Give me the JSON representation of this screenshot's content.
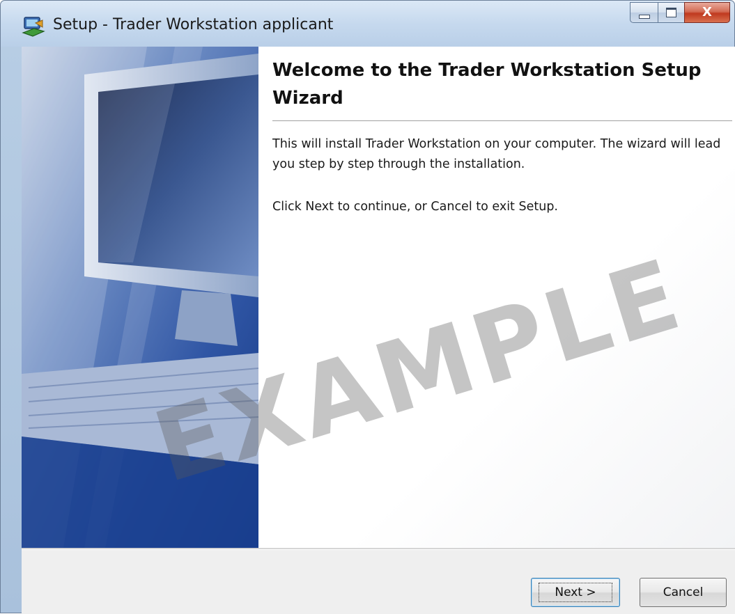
{
  "window": {
    "title": "Setup - Trader Workstation applicant",
    "caption_buttons": [
      "minimize",
      "maximize",
      "close"
    ],
    "close_glyph": "X"
  },
  "icons": {
    "app": "setup-installer-icon",
    "minimize": "minimize-icon",
    "maximize": "maximize-icon",
    "close": "close-icon"
  },
  "wizard": {
    "heading": "Welcome to the Trader Workstation Setup Wizard",
    "paragraph1": "This will install Trader Workstation on your computer. The wizard will lead you step by step through the installation.",
    "paragraph2": "Click Next to continue, or Cancel to exit Setup.",
    "side_image": "computer-monitor-keyboard-illustration"
  },
  "watermark": "EXAMPLE",
  "buttons": {
    "next": "Next >",
    "cancel": "Cancel"
  },
  "colors": {
    "close_button": "#c0391f",
    "side_panel": "#2d4f9c",
    "default_button_border": "#3c7fb1"
  }
}
